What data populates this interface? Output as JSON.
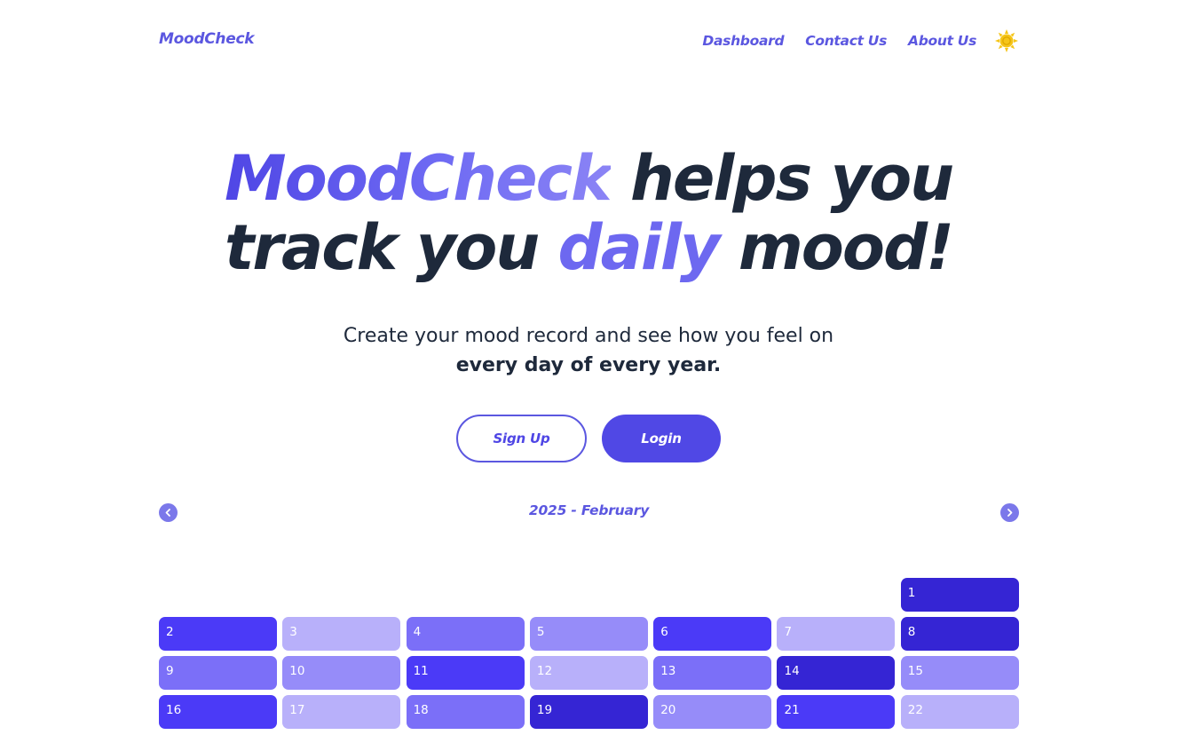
{
  "header": {
    "logo": "MoodCheck",
    "nav": [
      "Dashboard",
      "Contact Us",
      "About Us"
    ],
    "theme_icon": "sun-icon"
  },
  "hero": {
    "title_part1": "MoodCheck",
    "title_part2": " helps you",
    "title_part3": "track you ",
    "title_part4": "daily",
    "title_part5": " mood!",
    "subtitle_line1": "Create your mood record and see how you feel on",
    "subtitle_line2": "every day of every year."
  },
  "buttons": {
    "signup": "Sign Up",
    "login": "Login"
  },
  "calendar": {
    "title": "2025 - February",
    "prev_icon": "chevron-left-icon",
    "next_icon": "chevron-right-icon",
    "leading_empty": 6,
    "days": [
      {
        "day": "1",
        "color": "#3525d4"
      },
      {
        "day": "2",
        "color": "#4b3af7"
      },
      {
        "day": "3",
        "color": "#b8b0fa"
      },
      {
        "day": "4",
        "color": "#7b6ff8"
      },
      {
        "day": "5",
        "color": "#968cf9"
      },
      {
        "day": "6",
        "color": "#4b3af7"
      },
      {
        "day": "7",
        "color": "#b8b0fa"
      },
      {
        "day": "8",
        "color": "#3525d4"
      },
      {
        "day": "9",
        "color": "#7b6ff8"
      },
      {
        "day": "10",
        "color": "#968cf9"
      },
      {
        "day": "11",
        "color": "#4b3af7"
      },
      {
        "day": "12",
        "color": "#b8b0fa"
      },
      {
        "day": "13",
        "color": "#7b6ff8"
      },
      {
        "day": "14",
        "color": "#3525d4"
      },
      {
        "day": "15",
        "color": "#968cf9"
      },
      {
        "day": "16",
        "color": "#4b3af7"
      },
      {
        "day": "17",
        "color": "#b8b0fa"
      },
      {
        "day": "18",
        "color": "#7b6ff8"
      },
      {
        "day": "19",
        "color": "#3525d4"
      },
      {
        "day": "20",
        "color": "#968cf9"
      },
      {
        "day": "21",
        "color": "#4b3af7"
      },
      {
        "day": "22",
        "color": "#b8b0fa"
      }
    ]
  },
  "colors": {
    "brand": "#5b57e0",
    "button": "#5048e5",
    "text_dark": "#1e293b",
    "sun": "#f5c518"
  }
}
